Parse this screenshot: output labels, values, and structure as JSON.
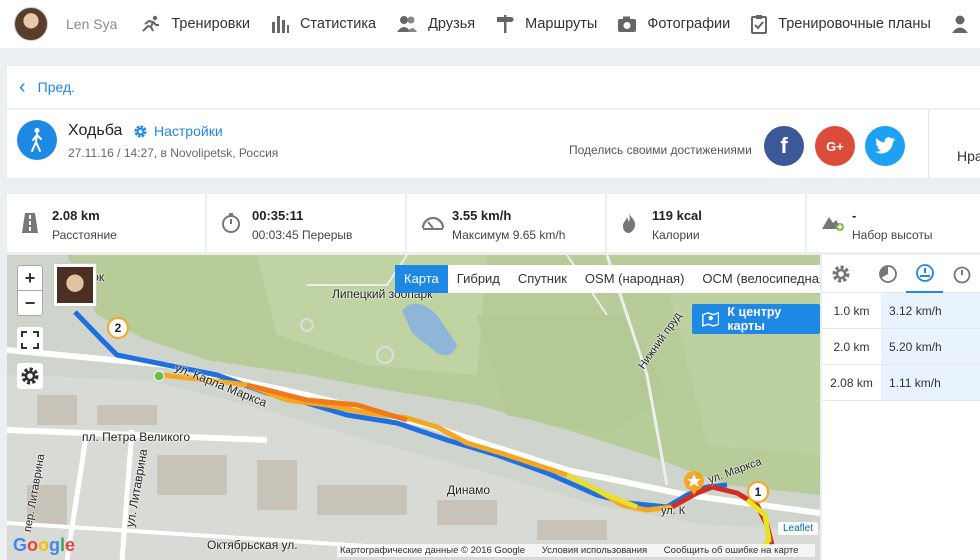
{
  "user": {
    "name": "Len Sya"
  },
  "nav": [
    {
      "label": "Тренировки",
      "icon": "runner-icon"
    },
    {
      "label": "Статистика",
      "icon": "bar-chart-icon"
    },
    {
      "label": "Друзья",
      "icon": "friends-icon"
    },
    {
      "label": "Маршруты",
      "icon": "signpost-icon"
    },
    {
      "label": "Фотографии",
      "icon": "camera-icon"
    },
    {
      "label": "Тренировочные планы",
      "icon": "clipboard-icon"
    }
  ],
  "back": {
    "label": "Пред."
  },
  "workout": {
    "title": "Ходьба",
    "settings_label": "Настройки",
    "subtitle": "27.11.16 / 14:27, в Novolipetsk, Россия",
    "share_label": "Поделись своими достижениями",
    "truncated_text": "Нра"
  },
  "stats": [
    {
      "value": "2.08 km",
      "label": "Расстояние",
      "icon": "road-icon"
    },
    {
      "value": "00:35:11",
      "label": "00:03:45 Перерыв",
      "icon": "stopwatch-icon"
    },
    {
      "value": "3.55 km/h",
      "label": "Максимум 9.65 km/h",
      "icon": "speedometer-icon"
    },
    {
      "value": "119 kcal",
      "label": "Калории",
      "icon": "flame-icon"
    },
    {
      "value": "-",
      "label": "Набор высоты",
      "icon": "mountain-icon"
    }
  ],
  "map": {
    "tabs": [
      "Карта",
      "Гибрид",
      "Спутник",
      "OSM (народная)",
      "OCM (велосипедная)"
    ],
    "active_tab": "Карта",
    "center_button": "К центру карты",
    "zoom_in": "+",
    "zoom_out": "−",
    "labels": {
      "park": "парк",
      "zoo": "Липецкий зоопарк",
      "karla_marksa": "ул. Карла Маркса",
      "petra": "пл. Петра Великого",
      "litavrina": "ул. Литаврина",
      "per_litavrina": "пер. Литаврина",
      "dinamo": "Динамо",
      "oktyabrskaya": "Октябрьская ул.",
      "nizhniy": "Нижний пруд",
      "marksa_end": "ул. Маркса",
      "ul_k": "ул. К"
    },
    "markers": {
      "start": "2",
      "end": "1"
    },
    "google": "Google",
    "leaflet": "Leaflet",
    "attribution": [
      "Картографические данные © 2016 Google",
      "Условия использования",
      "Сообщить об ошибке на карте"
    ]
  },
  "splits": {
    "rows": [
      {
        "distance": "1.0 km",
        "speed": "3.12 km/h"
      },
      {
        "distance": "2.0 km",
        "speed": "5.20 km/h"
      },
      {
        "distance": "2.08 km",
        "speed": "1.11 km/h"
      }
    ]
  },
  "colors": {
    "accent": "#1e88e5",
    "facebook": "#3b5998",
    "googleplus": "#dd4b39",
    "twitter": "#1da1f2"
  }
}
